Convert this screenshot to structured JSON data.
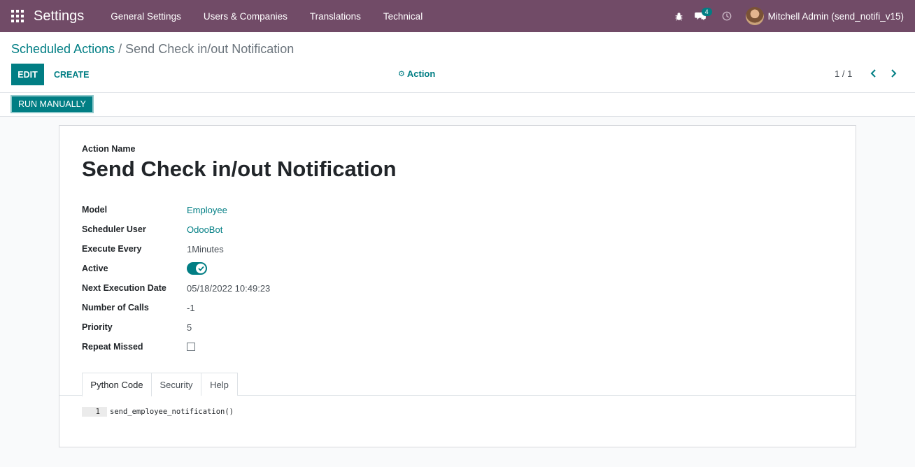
{
  "navbar": {
    "brand": "Settings",
    "menu": [
      "General Settings",
      "Users & Companies",
      "Translations",
      "Technical"
    ],
    "messages_count": "4",
    "user_name": "Mitchell Admin (send_notifi_v15)",
    "icons": [
      "apps-grid-icon",
      "bug-icon",
      "chat-icon",
      "clock-icon"
    ]
  },
  "breadcrumb": {
    "parent": "Scheduled Actions",
    "separator": "/",
    "current": "Send Check in/out Notification"
  },
  "toolbar": {
    "edit_label": "EDIT",
    "create_label": "CREATE",
    "action_label": "Action",
    "pager": "1 / 1"
  },
  "statusbar": {
    "run_label": "RUN MANUALLY"
  },
  "form": {
    "name_label": "Action Name",
    "title": "Send Check in/out Notification",
    "fields": {
      "model": {
        "label": "Model",
        "value": "Employee"
      },
      "user": {
        "label": "Scheduler User",
        "value": "OdooBot"
      },
      "interval": {
        "label": "Execute Every",
        "value": "1Minutes"
      },
      "active": {
        "label": "Active",
        "value": true
      },
      "nextcall": {
        "label": "Next Execution Date",
        "value": "05/18/2022 10:49:23"
      },
      "numbercall": {
        "label": "Number of Calls",
        "value": "-1"
      },
      "priority": {
        "label": "Priority",
        "value": "5"
      },
      "doall": {
        "label": "Repeat Missed",
        "value": false
      }
    },
    "tabs": [
      "Python Code",
      "Security",
      "Help"
    ],
    "active_tab": "Python Code",
    "code": {
      "line_number": "1",
      "text": "send_employee_notification()"
    }
  },
  "colors": {
    "navbar": "#714b67",
    "accent": "#017e84"
  }
}
